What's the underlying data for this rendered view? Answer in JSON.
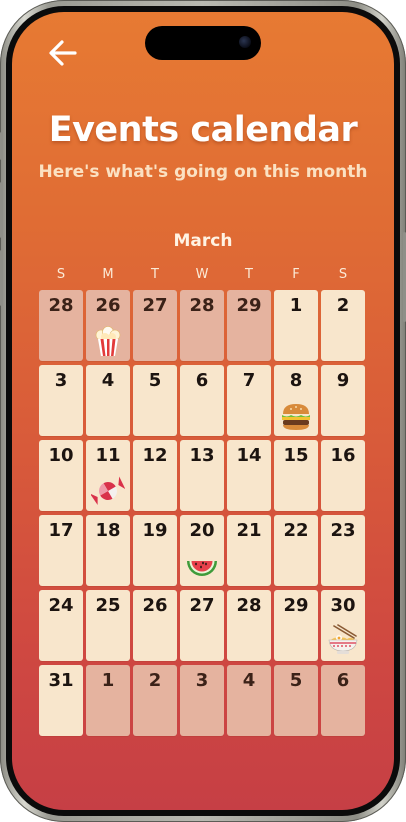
{
  "header": {
    "back_icon": "arrow-left-icon",
    "title": "Events calendar",
    "subtitle": "Here's what's going on this month"
  },
  "calendar": {
    "month": "March",
    "weekdays": [
      "S",
      "M",
      "T",
      "W",
      "T",
      "F",
      "S"
    ],
    "weeks": [
      [
        {
          "day": "28",
          "muted": true
        },
        {
          "day": "26",
          "muted": true,
          "icon": "popcorn-icon"
        },
        {
          "day": "27",
          "muted": true
        },
        {
          "day": "28",
          "muted": true
        },
        {
          "day": "29",
          "muted": true
        },
        {
          "day": "1",
          "muted": false
        },
        {
          "day": "2",
          "muted": false
        }
      ],
      [
        {
          "day": "3",
          "muted": false
        },
        {
          "day": "4",
          "muted": false
        },
        {
          "day": "5",
          "muted": false
        },
        {
          "day": "6",
          "muted": false
        },
        {
          "day": "7",
          "muted": false
        },
        {
          "day": "8",
          "muted": false,
          "icon": "burger-icon"
        },
        {
          "day": "9",
          "muted": false
        }
      ],
      [
        {
          "day": "10",
          "muted": false
        },
        {
          "day": "11",
          "muted": false,
          "icon": "candy-icon"
        },
        {
          "day": "12",
          "muted": false
        },
        {
          "day": "13",
          "muted": false
        },
        {
          "day": "14",
          "muted": false
        },
        {
          "day": "15",
          "muted": false
        },
        {
          "day": "16",
          "muted": false
        }
      ],
      [
        {
          "day": "17",
          "muted": false
        },
        {
          "day": "18",
          "muted": false
        },
        {
          "day": "19",
          "muted": false
        },
        {
          "day": "20",
          "muted": false,
          "icon": "watermelon-icon"
        },
        {
          "day": "21",
          "muted": false
        },
        {
          "day": "22",
          "muted": false
        },
        {
          "day": "23",
          "muted": false
        }
      ],
      [
        {
          "day": "24",
          "muted": false
        },
        {
          "day": "25",
          "muted": false
        },
        {
          "day": "26",
          "muted": false
        },
        {
          "day": "27",
          "muted": false
        },
        {
          "day": "28",
          "muted": false
        },
        {
          "day": "29",
          "muted": false
        },
        {
          "day": "30",
          "muted": false,
          "icon": "ramen-icon"
        }
      ],
      [
        {
          "day": "31",
          "muted": false
        },
        {
          "day": "1",
          "muted": true
        },
        {
          "day": "2",
          "muted": true
        },
        {
          "day": "3",
          "muted": true
        },
        {
          "day": "4",
          "muted": true
        },
        {
          "day": "5",
          "muted": true
        },
        {
          "day": "6",
          "muted": true
        }
      ]
    ]
  },
  "colors": {
    "background_top": "#e77a33",
    "background_bottom": "#c63f45",
    "cell": "#f8e6cc",
    "cell_muted": "#e5b39f"
  }
}
